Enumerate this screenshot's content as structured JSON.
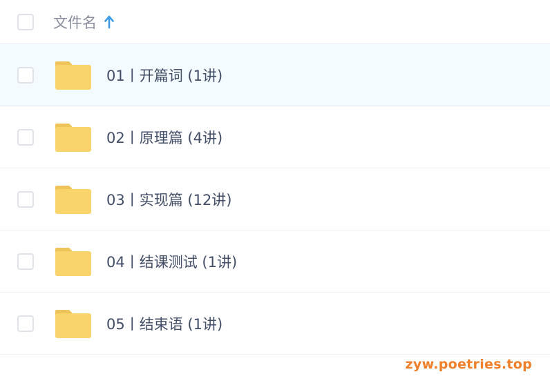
{
  "header": {
    "column_label": "文件名",
    "sort_icon": "arrow-up-icon",
    "accent": "#3d9be9"
  },
  "rows": [
    {
      "label": "01丨开篇词 (1讲)",
      "icon": "folder-icon"
    },
    {
      "label": "02丨原理篇 (4讲)",
      "icon": "folder-icon"
    },
    {
      "label": "03丨实现篇 (12讲)",
      "icon": "folder-icon"
    },
    {
      "label": "04丨结课测试 (1讲)",
      "icon": "folder-icon"
    },
    {
      "label": "05丨结束语 (1讲)",
      "icon": "folder-icon"
    }
  ],
  "colors": {
    "folder": "#f9d36b",
    "folder_tab": "#eec45a",
    "hover_row": "#f4fbff",
    "text": "#424e67"
  },
  "watermark": "zyw.poetries.top"
}
